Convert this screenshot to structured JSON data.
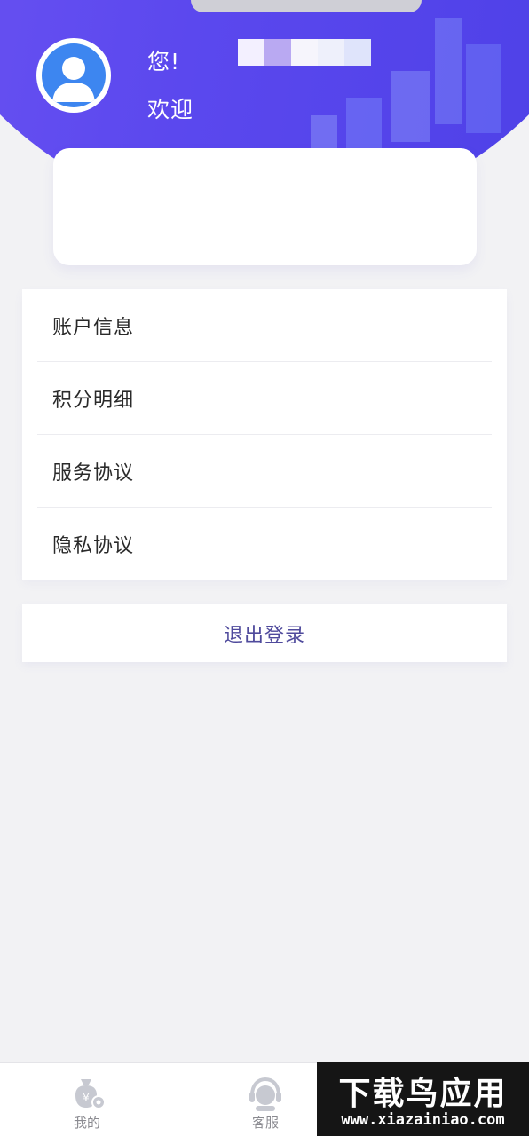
{
  "header": {
    "greeting_line1": "您!",
    "greeting_line2": "欢迎",
    "colors": {
      "gradient_start": "#6e55f3",
      "gradient_end": "#4b3fe6"
    }
  },
  "avatar": {
    "icon": "user-avatar-icon"
  },
  "menu": {
    "items": [
      {
        "label": "账户信息"
      },
      {
        "label": "积分明细"
      },
      {
        "label": "服务协议"
      },
      {
        "label": "隐私协议"
      }
    ]
  },
  "logout": {
    "label": "退出登录",
    "color": "#4f4a9c"
  },
  "tabbar": {
    "tabs": [
      {
        "label": "我的",
        "icon": "money-bag-icon"
      },
      {
        "label": "客服",
        "icon": "headset-icon"
      }
    ]
  },
  "watermark": {
    "title": "下载鸟应用",
    "url": "www.xiazainiao.com"
  }
}
